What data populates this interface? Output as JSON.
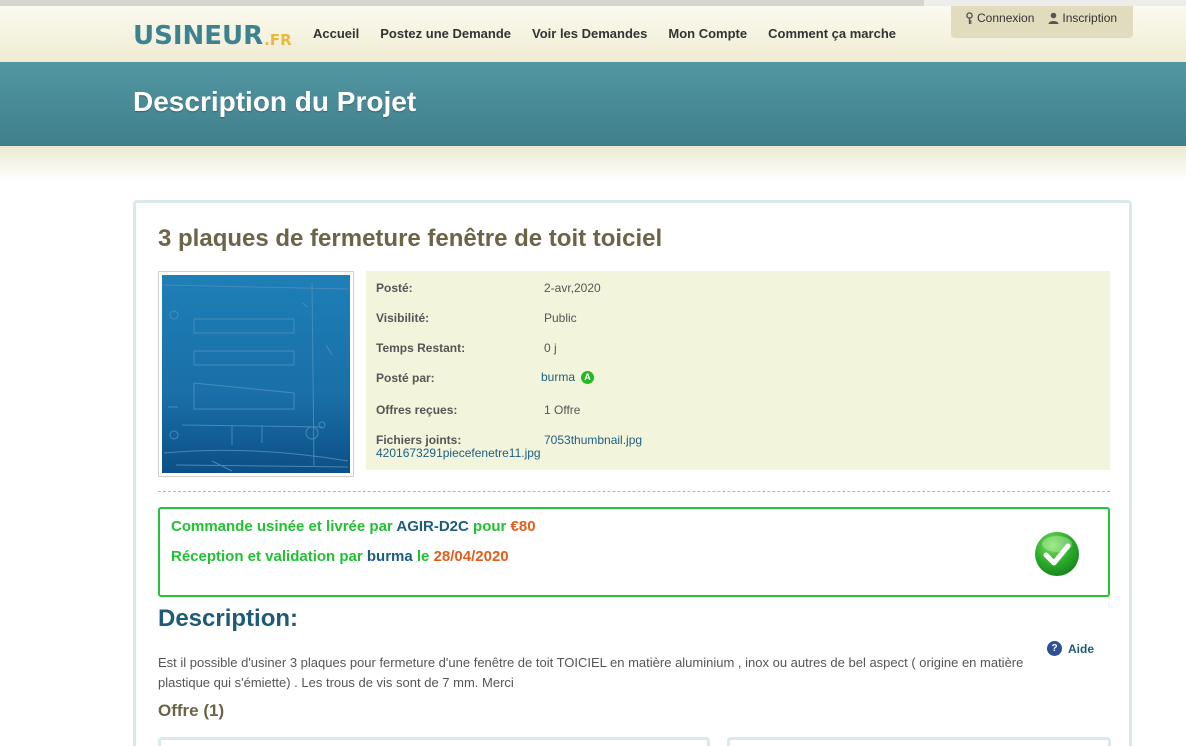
{
  "logo": {
    "main": "USINEUR",
    "suffix": ".FR"
  },
  "nav": {
    "items": [
      "Accueil",
      "Postez une Demande",
      "Voir les Demandes",
      "Mon Compte",
      "Comment ça marche"
    ]
  },
  "account": {
    "login": "Connexion",
    "register": "Inscription"
  },
  "banner": {
    "title": "Description du Projet"
  },
  "project": {
    "title": "3 plaques de fermeture fenêtre de toit toiciel",
    "posted_label": "Posté:",
    "posted_value": "2-avr,2020",
    "visibility_label": "Visibilité:",
    "visibility_value": "Public",
    "remaining_label": "Temps Restant:",
    "remaining_value": "0 j",
    "posted_by_label": "Posté par:",
    "posted_by_value": "burma",
    "posted_by_badge": "A",
    "offers_label": "Offres reçues:",
    "offers_value": "1 Offre",
    "files_label": "Fichiers joints:",
    "file_1": "7053thumbnail.jpg",
    "file_2": "4201673291piecefenetre11.jpg"
  },
  "order": {
    "line1_a": "Commande usinée et livrée par ",
    "line1_vendor": "AGIR-D2C",
    "line1_b": " pour ",
    "line1_price": "€80",
    "line2_a": "Réception et validation par ",
    "line2_user": "burma",
    "line2_b": " le ",
    "line2_date": "28/04/2020"
  },
  "description": {
    "title": "Description:",
    "help": "Aide",
    "text": "Est il possible d'usiner 3 plaques pour fermeture d'une fenêtre de toit TOICIEL en matière aluminium , inox ou autres de bel aspect ( origine en matière plastique qui s'émiette) . Les trous de vis sont de 7 mm. Merci"
  },
  "offers": {
    "title": "Offre (1)"
  },
  "colors": {
    "brand_teal": "#3d8291",
    "banner": "#4a8e9a",
    "success_green": "#22c033",
    "link_blue": "#1c5e7e",
    "price_orange": "#e25e1d"
  }
}
